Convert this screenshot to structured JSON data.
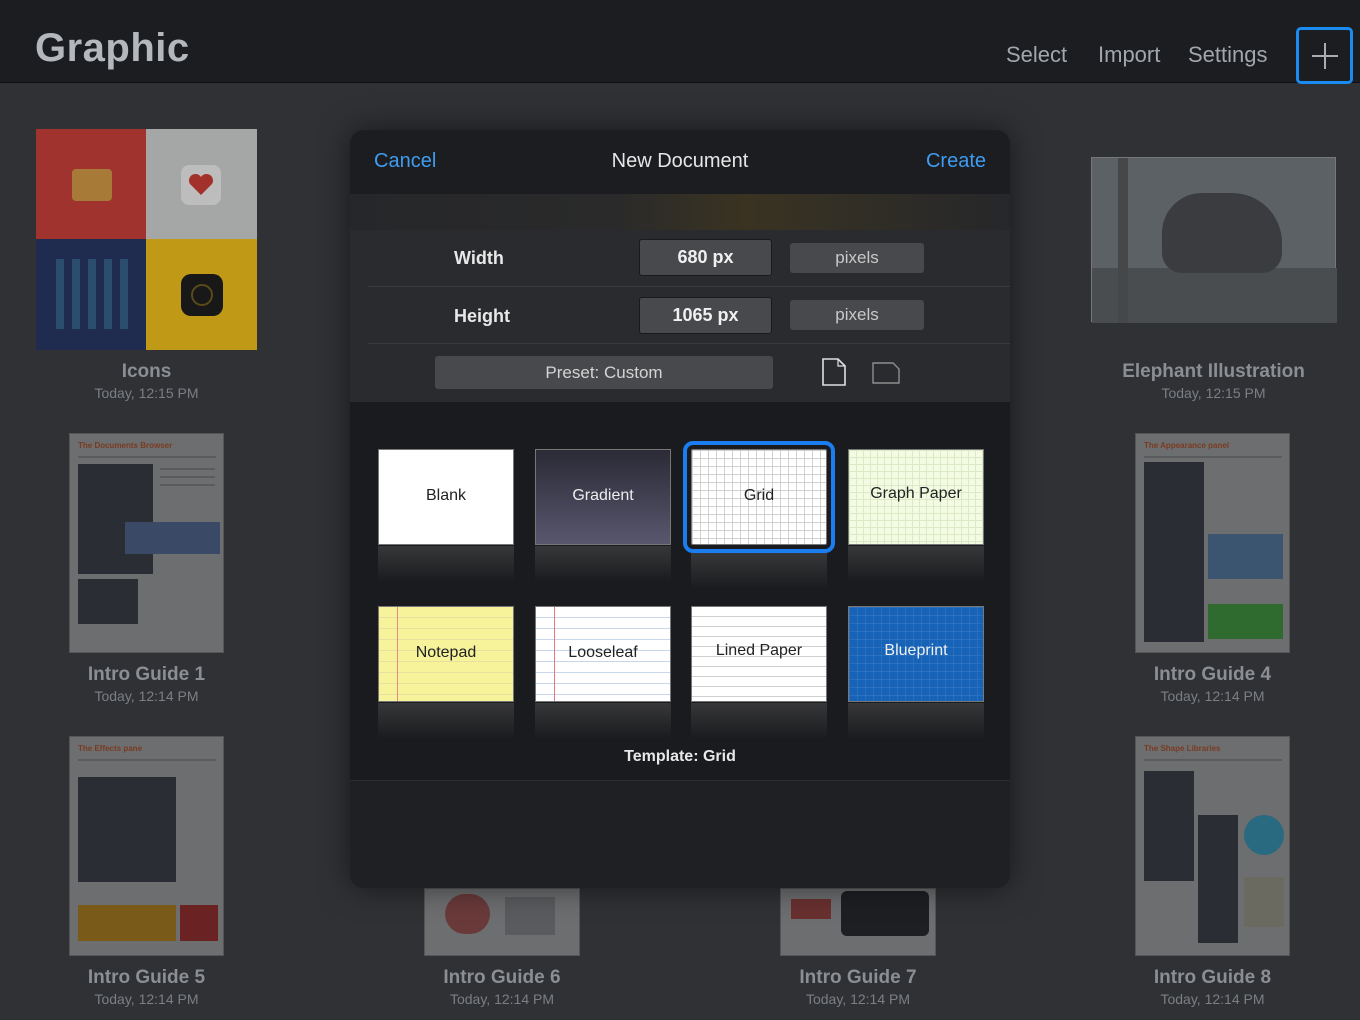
{
  "app": {
    "title": "Graphic"
  },
  "nav": {
    "select": "Select",
    "import": "Import",
    "settings": "Settings",
    "add_icon": "plus-icon"
  },
  "documents": [
    {
      "name": "Icons",
      "date": "Today, 12:15 PM"
    },
    {
      "name": "Elephant Illustration",
      "date": "Today, 12:15 PM"
    },
    {
      "name": "Intro Guide 1",
      "date": "Today, 12:14 PM",
      "header": "The Documents Browser"
    },
    {
      "name": "Intro Guide 4",
      "date": "Today, 12:14 PM",
      "header": "The Appearance panel"
    },
    {
      "name": "Intro Guide 5",
      "date": "Today, 12:14 PM",
      "header": "The Effects pane"
    },
    {
      "name": "Intro Guide 6",
      "date": "Today, 12:14 PM"
    },
    {
      "name": "Intro Guide 7",
      "date": "Today, 12:14 PM"
    },
    {
      "name": "Intro Guide 8",
      "date": "Today, 12:14 PM",
      "header": "The Shape Libraries"
    }
  ],
  "modal": {
    "cancel": "Cancel",
    "title": "New Document",
    "create": "Create",
    "width_label": "Width",
    "width_value": "680 px",
    "width_unit": "pixels",
    "height_label": "Height",
    "height_value": "1065 px",
    "height_unit": "pixels",
    "preset": "Preset: Custom",
    "orientation_icons": [
      "portrait-page-icon",
      "landscape-page-icon"
    ],
    "templates": [
      {
        "name": "Blank"
      },
      {
        "name": "Gradient"
      },
      {
        "name": "Grid"
      },
      {
        "name": "Graph Paper"
      },
      {
        "name": "Notepad"
      },
      {
        "name": "Looseleaf"
      },
      {
        "name": "Lined Paper"
      },
      {
        "name": "Blueprint"
      }
    ],
    "selected_template_label": "Template: Grid"
  },
  "colors": {
    "accent": "#1a8bf0",
    "link": "#3f9cf0"
  }
}
